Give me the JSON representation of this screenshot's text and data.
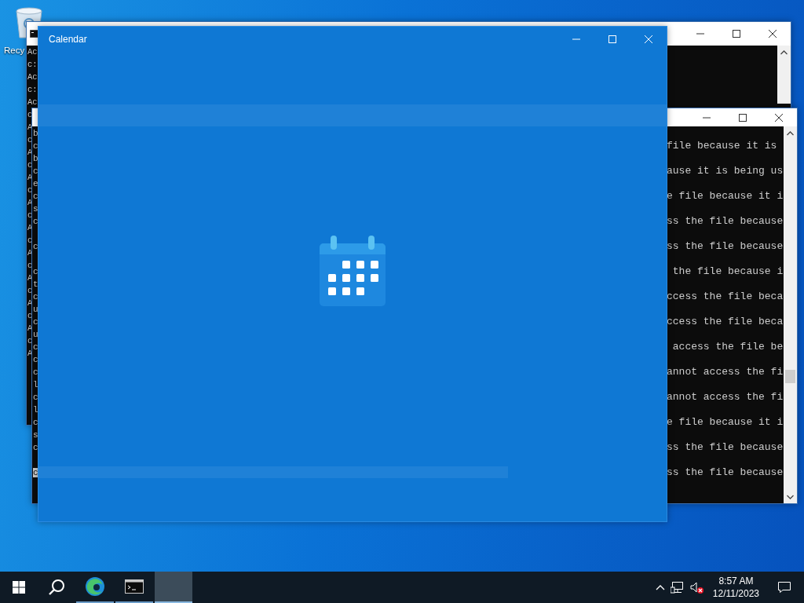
{
  "desktop": {
    "icons": [
      {
        "label": "Recy"
      }
    ]
  },
  "back_console": {
    "lines": [
      "Ac",
      "c:",
      "Ac",
      "c:",
      "Ac",
      "c",
      "A",
      "c",
      "A",
      "c",
      "A",
      "c",
      "A",
      "c",
      "A",
      "c",
      "A",
      "c",
      "A",
      "c",
      "A",
      "c",
      "A",
      "c",
      "A"
    ]
  },
  "front_console": {
    "rows": [
      {
        "head": "b",
        "selected": false
      },
      {
        "head": "c",
        "tail": "file because it is",
        "selected": false
      },
      {
        "head": "b",
        "selected": false
      },
      {
        "head": "c",
        "tail": "ause it is being us",
        "selected": false
      },
      {
        "head": "e",
        "selected": false
      },
      {
        "head": "c",
        "tail": "e file because it i",
        "selected": false
      },
      {
        "head": "s",
        "selected": false
      },
      {
        "head": "c",
        "tail": "ss the file because",
        "selected": false
      },
      {
        "selected": false
      },
      {
        "head": "c",
        "tail": "ss the file because",
        "selected": false
      },
      {
        "selected": false
      },
      {
        "head": "c",
        "tail": " the file because i",
        "selected": false
      },
      {
        "head": "t",
        "selected": false
      },
      {
        "head": "c",
        "tail": "ccess the file beca",
        "selected": false
      },
      {
        "head": "u",
        "selected": false
      },
      {
        "head": "c",
        "tail": "ccess the file beca",
        "selected": false
      },
      {
        "head": "u",
        "selected": false
      },
      {
        "head": "c",
        "tail": " access the file be",
        "selected": false
      },
      {
        "head": "c",
        "selected": false
      },
      {
        "head": "c",
        "tail": "annot access the fi",
        "selected": false
      },
      {
        "head": "l",
        "selected": false
      },
      {
        "head": "c",
        "tail": "annot access the fi",
        "selected": false
      },
      {
        "head": "l",
        "selected": false
      },
      {
        "head": "c",
        "tail": "e file because it i",
        "selected": false
      },
      {
        "head": "s",
        "selected": false
      },
      {
        "head": "c",
        "tail": "ss the file because",
        "selected": false
      },
      {
        "selected": false
      },
      {
        "head": "c",
        "tail": "ss the file because",
        "selected": true
      }
    ]
  },
  "calendar_window": {
    "title": "Calendar"
  },
  "taskbar": {
    "apps": [
      {
        "kind": "edge",
        "selected": false
      },
      {
        "kind": "terminal",
        "selected": false
      },
      {
        "kind": "blank",
        "selected": true
      }
    ],
    "tray": {
      "volume_muted": true
    },
    "clock": {
      "time": "8:57 AM",
      "date": "12/11/2023"
    }
  }
}
